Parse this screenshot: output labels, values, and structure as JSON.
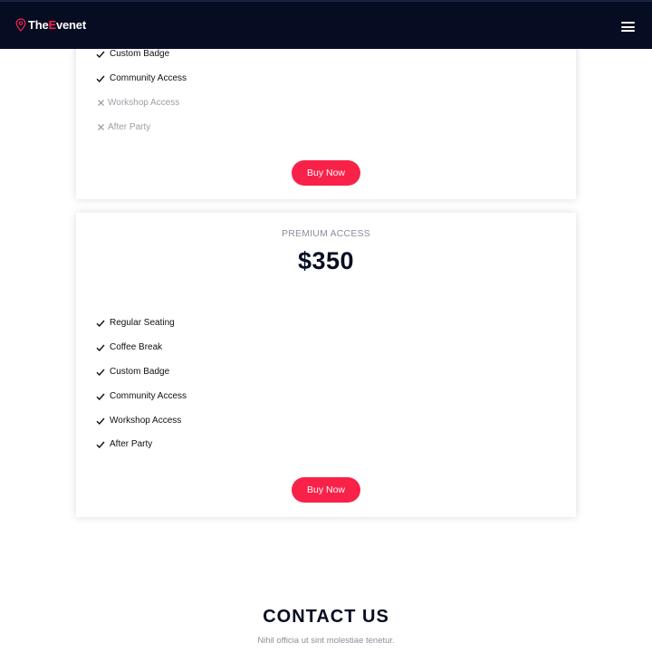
{
  "header": {
    "logo_prefix": "The",
    "logo_accent": "E",
    "logo_suffix": "venet"
  },
  "card_top": {
    "features": [
      {
        "label": "Custom Badge",
        "included": true
      },
      {
        "label": "Community Access",
        "included": true
      },
      {
        "label": "Workshop Access",
        "included": false
      },
      {
        "label": "After Party",
        "included": false
      }
    ],
    "button_label": "Buy Now"
  },
  "card_premium": {
    "title": "PREMIUM ACCESS",
    "price": "$350",
    "features": [
      {
        "label": "Regular Seating",
        "included": true
      },
      {
        "label": "Coffee Break",
        "included": true
      },
      {
        "label": "Custom Badge",
        "included": true
      },
      {
        "label": "Community Access",
        "included": true
      },
      {
        "label": "Workshop Access",
        "included": true
      },
      {
        "label": "After Party",
        "included": true
      }
    ],
    "button_label": "Buy Now"
  },
  "contact": {
    "title": "CONTACT US",
    "subtitle": "Nihil officia ut sint molestiae tenetur."
  },
  "colors": {
    "header_bg": "#060c22",
    "accent": "#f82249",
    "heading": "#060c22",
    "muted": "#8a8f9a"
  }
}
